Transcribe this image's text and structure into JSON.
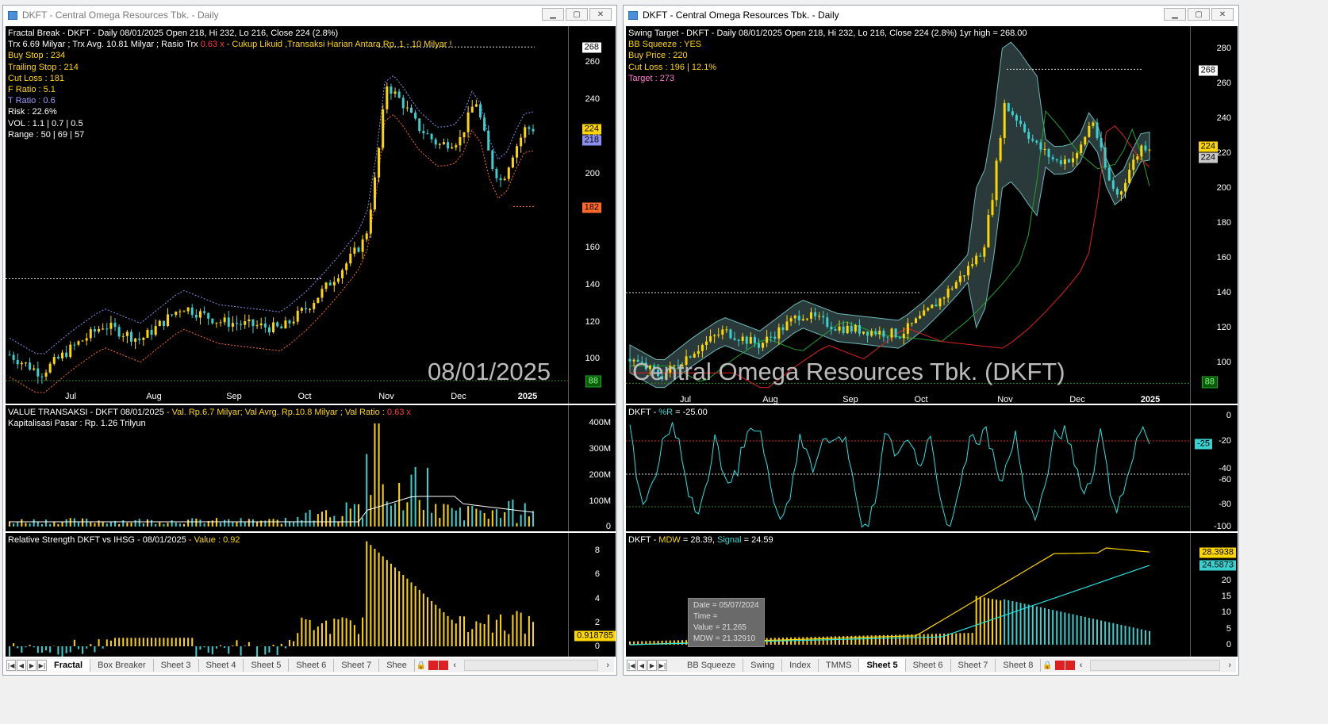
{
  "left": {
    "title": "DKFT - Central Omega Resources Tbk. - Daily",
    "main": {
      "l1": "Fractal Break - DKFT - Daily 08/01/2025 Open 218, Hi 232, Lo 216, Close 224 (2.8%)",
      "l2a": "Trx  6.69 Milyar ;  Trx Avg. 10.81 Milyar ;  Rasio Trx ",
      "l2b": "0.63 x",
      "l2c": "   - Cukup Likuid ,Transaksi Harian Antara Rp. 1 - 10 Milyar !",
      "buystop": "Buy Stop : 234",
      "trail": "Trailing Stop : 214",
      "cutloss": "Cut Loss : 181",
      "fratio": "F Ratio : 5.1",
      "tratio": "T Ratio : 0.6",
      "risk": "Risk : 22.6%",
      "vol": "VOL : 1.1 | 0.7 | 0.5",
      "range": "Range : 50 | 69 | 57",
      "watermark": "08/01/2025",
      "ticks": [
        "260",
        "240",
        "220",
        "200",
        "180",
        "160",
        "140",
        "120",
        "100"
      ],
      "tag268": "268",
      "tag224": "224",
      "tag218": "218",
      "tag182": "182",
      "tag88": "88",
      "xlabels": [
        "Jul",
        "Aug",
        "Sep",
        "Oct",
        "Nov",
        "Dec",
        "2025"
      ]
    },
    "value": {
      "l1a": "VALUE TRANSAKSI - DKFT  08/01/2025 ",
      "l1b": " - Val. Rp.6.7 Milyar;  Val Avrg. Rp.10.8 Milyar ; Val Ratio : ",
      "l1c": " 0.63 x",
      "l2": "Kapitalisasi Pasar : Rp. 1.26 Trilyun",
      "ticks": [
        "400M",
        "300M",
        "200M",
        "100M",
        "0"
      ]
    },
    "rs": {
      "l1a": "Relative Strength DKFT  vs IHSG - 08/01/2025 ",
      "l1b": " - Value : 0.92",
      "ticks": [
        "8",
        "6",
        "4",
        "2",
        "0"
      ],
      "tag": "0.918785"
    },
    "tabs": [
      "Fractal",
      "Box Breaker",
      "Sheet 3",
      "Sheet 4",
      "Sheet 5",
      "Sheet 6",
      "Sheet 7",
      "Shee"
    ]
  },
  "right": {
    "title": "DKFT - Central Omega Resources Tbk. - Daily",
    "main": {
      "l1": "Swing Target - DKFT - Daily 08/01/2025 Open 218, Hi 232, Lo 216, Close 224 (2.8%) 1yr high = 268.00",
      "bb": "BB Squeeze : YES",
      "buy": "Buy Price : 220",
      "cut": "Cut Loss : 196 | 12.1%",
      "target": "Target : 273",
      "watermark": "Central Omega Resources Tbk. (DKFT)",
      "ticks": [
        "280",
        "260",
        "240",
        "220",
        "200",
        "180",
        "160",
        "140",
        "120",
        "100"
      ],
      "tag268": "268",
      "tag224a": "224",
      "tag224b": "224",
      "tag88": "88",
      "xlabels": [
        "Jul",
        "Aug",
        "Sep",
        "Oct",
        "Nov",
        "Dec",
        "2025"
      ]
    },
    "wr": {
      "l1a": "DKFT - ",
      "l1b": "%R",
      "l1c": " = -25.00",
      "ticks": [
        "0",
        "-20",
        "-40",
        "-60",
        "-80",
        "-100"
      ],
      "tag": "-25"
    },
    "mdw": {
      "l1a": "DKFT - ",
      "l1b": "MDW",
      "l1c": " = 28.39, ",
      "l1d": "Signal",
      "l1e": " = 24.59",
      "ticks": [
        "25",
        "20",
        "15",
        "10",
        "5",
        "0"
      ],
      "tag1": "28.3938",
      "tag2": "24.5873",
      "tooltip": [
        "Date = 05/07/2024",
        "Time =",
        "Value = 21.265",
        "MDW = 21.32910"
      ]
    },
    "tabs": [
      "BB Squeeze",
      "Swing",
      "Index",
      "TMMS",
      "Sheet 5",
      "Sheet 6",
      "Sheet 7",
      "Sheet 8"
    ]
  },
  "colors": {
    "up": "#ffd700",
    "down": "#3ad0d0",
    "signal": "#2ae0e0",
    "bb": "#8a8ff0",
    "ma": "#e02020",
    "ma2": "#22a030"
  }
}
